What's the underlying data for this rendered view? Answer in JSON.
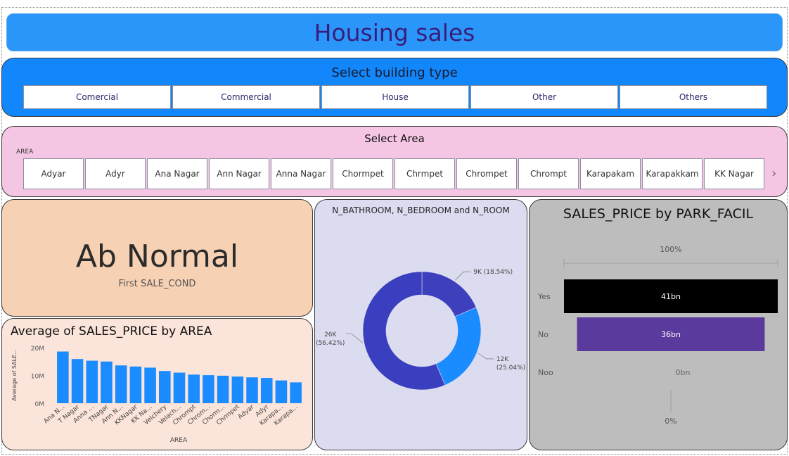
{
  "header": {
    "title": "Housing sales"
  },
  "building_slicer": {
    "title": "Select building type",
    "options": [
      "Comercial",
      "Commercial",
      "House",
      "Other",
      "Others"
    ]
  },
  "area_slicer": {
    "title": "Select Area",
    "header": "AREA",
    "options": [
      "Adyar",
      "Adyr",
      "Ana Nagar",
      "Ann Nagar",
      "Anna Nagar",
      "Chormpet",
      "Chrmpet",
      "Chrompet",
      "Chrompt",
      "Karapakam",
      "Karapakkam",
      "KK Nagar"
    ],
    "next_icon": "chevron-right-icon"
  },
  "card": {
    "value": "Ab Normal",
    "label": "First SALE_COND"
  },
  "chart_data": [
    {
      "type": "bar",
      "title": "Average of SALES_PRICE by AREA",
      "xlabel": "AREA",
      "ylabel": "Average of SALE...",
      "yticks": [
        "20M",
        "10M",
        "0M"
      ],
      "ylim": [
        0,
        20
      ],
      "categories": [
        "Ana N...",
        "T Nagar",
        "Anna ...",
        "TNagar",
        "Ann N...",
        "KKNagar",
        "KK Na...",
        "Velchery",
        "Velach...",
        "Chrompt",
        "Chrom...",
        "Chorm...",
        "Chrmpet",
        "Adyar",
        "Adyr",
        "Karapa...",
        "Karapa..."
      ],
      "values": [
        18.6,
        15.9,
        15.3,
        15.0,
        13.6,
        13.2,
        12.8,
        11.6,
        11.0,
        10.3,
        10.1,
        9.9,
        9.6,
        9.3,
        9.1,
        8.2,
        7.5
      ],
      "color": "#1a8cff"
    },
    {
      "type": "pie",
      "title": "N_BATHROOM, N_BEDROOM and N_ROOM",
      "slices": [
        {
          "label": "9K (18.54%)",
          "value": 18.54,
          "color": "#3e3fbd"
        },
        {
          "label": "12K",
          "sub": "(25.04%)",
          "value": 25.04,
          "color": "#1a8cff"
        },
        {
          "label": "26K",
          "sub": "(56.42%)",
          "value": 56.42,
          "color": "#3a3fbf"
        }
      ]
    },
    {
      "type": "bar",
      "title": "SALES_PRICE by PARK_FACIL",
      "top_label": "100%",
      "bottom_label": "0%",
      "categories": [
        "Yes",
        "No",
        "Noo"
      ],
      "values": [
        41,
        36,
        0
      ],
      "labels": [
        "41bn",
        "36bn",
        "0bn"
      ],
      "colors": [
        "#000000",
        "#5a3a9c",
        "#5a3a9c"
      ]
    }
  ]
}
